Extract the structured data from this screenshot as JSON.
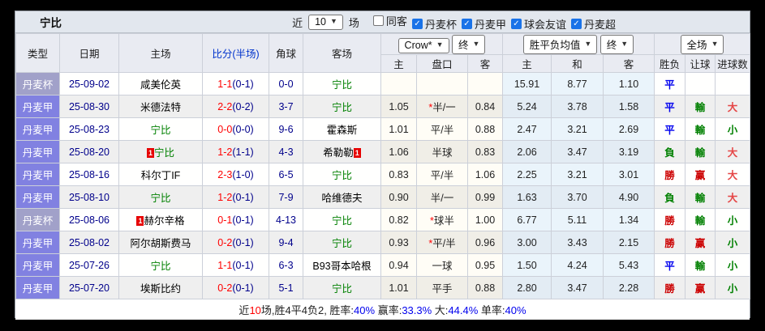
{
  "titlebar": {
    "title": "宁比",
    "near_label": "近",
    "count_value": "10",
    "unit_label": "场",
    "filters": [
      {
        "label": "同客",
        "checked": false
      },
      {
        "label": "丹麦杯",
        "checked": true
      },
      {
        "label": "丹麦甲",
        "checked": true
      },
      {
        "label": "球会友谊",
        "checked": true
      },
      {
        "label": "丹麦超",
        "checked": true
      }
    ]
  },
  "header": {
    "cols": {
      "type": "类型",
      "date": "日期",
      "home": "主场",
      "score": "比分(半场)",
      "corner": "角球",
      "away": "客场",
      "sub": [
        "主",
        "盘口",
        "客",
        "主",
        "和",
        "客",
        "胜负",
        "让球",
        "进球数"
      ]
    },
    "selects": {
      "bookmaker": "Crow*",
      "bookmaker_state": "终",
      "avg": "胜平负均值",
      "avg_state": "终",
      "scope": "全场"
    }
  },
  "table": {
    "rows": [
      {
        "type": "丹麦杯",
        "date": "25-09-02",
        "home": "咸美伦英",
        "home_green": false,
        "home_card": "",
        "score": "1-1",
        "half": "(0-1)",
        "corner": "0-0",
        "away": "宁比",
        "away_green": true,
        "away_card": "",
        "odds_home": "",
        "handicap": "",
        "handicap_star": false,
        "odds_away": "",
        "avg_win": "15.91",
        "avg_draw": "8.77",
        "avg_lose": "1.10",
        "result": "平",
        "handicap_result": "",
        "goals": ""
      },
      {
        "type": "丹麦甲",
        "date": "25-08-30",
        "home": "米德法特",
        "home_green": false,
        "home_card": "",
        "score": "2-2",
        "half": "(0-2)",
        "corner": "3-7",
        "away": "宁比",
        "away_green": true,
        "away_card": "",
        "odds_home": "1.05",
        "handicap": "半/一",
        "handicap_star": true,
        "odds_away": "0.84",
        "avg_win": "5.24",
        "avg_draw": "3.78",
        "avg_lose": "1.58",
        "result": "平",
        "handicap_result": "輸",
        "goals": "大"
      },
      {
        "type": "丹麦甲",
        "date": "25-08-23",
        "home": "宁比",
        "home_green": true,
        "home_card": "",
        "score": "0-0",
        "half": "(0-0)",
        "corner": "9-6",
        "away": "霍森斯",
        "away_green": false,
        "away_card": "",
        "odds_home": "1.01",
        "handicap": "平/半",
        "handicap_star": false,
        "odds_away": "0.88",
        "avg_win": "2.47",
        "avg_draw": "3.21",
        "avg_lose": "2.69",
        "result": "平",
        "handicap_result": "輸",
        "goals": "小"
      },
      {
        "type": "丹麦甲",
        "date": "25-08-20",
        "home": "宁比",
        "home_green": true,
        "home_card": "1",
        "score": "1-2",
        "half": "(1-1)",
        "corner": "4-3",
        "away": "希勒勒",
        "away_green": false,
        "away_card": "1",
        "odds_home": "1.06",
        "handicap": "半球",
        "handicap_star": false,
        "odds_away": "0.83",
        "avg_win": "2.06",
        "avg_draw": "3.47",
        "avg_lose": "3.19",
        "result": "負",
        "handicap_result": "輸",
        "goals": "大"
      },
      {
        "type": "丹麦甲",
        "date": "25-08-16",
        "home": "科尔丁IF",
        "home_green": false,
        "home_card": "",
        "score": "2-3",
        "half": "(1-0)",
        "corner": "6-5",
        "away": "宁比",
        "away_green": true,
        "away_card": "",
        "odds_home": "0.83",
        "handicap": "平/半",
        "handicap_star": false,
        "odds_away": "1.06",
        "avg_win": "2.25",
        "avg_draw": "3.21",
        "avg_lose": "3.01",
        "result": "勝",
        "handicap_result": "赢",
        "goals": "大"
      },
      {
        "type": "丹麦甲",
        "date": "25-08-10",
        "home": "宁比",
        "home_green": true,
        "home_card": "",
        "score": "1-2",
        "half": "(0-1)",
        "corner": "7-9",
        "away": "哈维德夫",
        "away_green": false,
        "away_card": "",
        "odds_home": "0.90",
        "handicap": "半/一",
        "handicap_star": false,
        "odds_away": "0.99",
        "avg_win": "1.63",
        "avg_draw": "3.70",
        "avg_lose": "4.90",
        "result": "負",
        "handicap_result": "輸",
        "goals": "大"
      },
      {
        "type": "丹麦杯",
        "date": "25-08-06",
        "home": "赫尔辛格",
        "home_green": false,
        "home_card": "1",
        "score": "0-1",
        "half": "(0-1)",
        "corner": "4-13",
        "away": "宁比",
        "away_green": true,
        "away_card": "",
        "odds_home": "0.82",
        "handicap": "球半",
        "handicap_star": true,
        "odds_away": "1.00",
        "avg_win": "6.77",
        "avg_draw": "5.11",
        "avg_lose": "1.34",
        "result": "勝",
        "handicap_result": "輸",
        "goals": "小"
      },
      {
        "type": "丹麦甲",
        "date": "25-08-02",
        "home": "阿尔胡斯费马",
        "home_green": false,
        "home_card": "",
        "score": "0-2",
        "half": "(0-1)",
        "corner": "9-4",
        "away": "宁比",
        "away_green": true,
        "away_card": "",
        "odds_home": "0.93",
        "handicap": "平/半",
        "handicap_star": true,
        "odds_away": "0.96",
        "avg_win": "3.00",
        "avg_draw": "3.43",
        "avg_lose": "2.15",
        "result": "勝",
        "handicap_result": "赢",
        "goals": "小"
      },
      {
        "type": "丹麦甲",
        "date": "25-07-26",
        "home": "宁比",
        "home_green": true,
        "home_card": "",
        "score": "1-1",
        "half": "(0-1)",
        "corner": "6-3",
        "away": "B93哥本哈根",
        "away_green": false,
        "away_card": "",
        "odds_home": "0.94",
        "handicap": "一球",
        "handicap_star": false,
        "odds_away": "0.95",
        "avg_win": "1.50",
        "avg_draw": "4.24",
        "avg_lose": "5.43",
        "result": "平",
        "handicap_result": "輸",
        "goals": "小"
      },
      {
        "type": "丹麦甲",
        "date": "25-07-20",
        "home": "埃斯比约",
        "home_green": false,
        "home_card": "",
        "score": "0-2",
        "half": "(0-1)",
        "corner": "5-1",
        "away": "宁比",
        "away_green": true,
        "away_card": "",
        "odds_home": "1.01",
        "handicap": "平手",
        "handicap_star": false,
        "odds_away": "0.88",
        "avg_win": "2.80",
        "avg_draw": "3.47",
        "avg_lose": "2.28",
        "result": "勝",
        "handicap_result": "赢",
        "goals": "小"
      }
    ]
  },
  "footer": {
    "segments": [
      {
        "text": "近",
        "color": ""
      },
      {
        "text": "10",
        "color": "red"
      },
      {
        "text": "场,胜4平4负2, 胜率:",
        "color": ""
      },
      {
        "text": "40%",
        "color": "blue"
      },
      {
        "text": " 赢率:",
        "color": ""
      },
      {
        "text": "33.3%",
        "color": "blue"
      },
      {
        "text": " 大:",
        "color": ""
      },
      {
        "text": "44.4%",
        "color": "blue"
      },
      {
        "text": " 单率:",
        "color": ""
      },
      {
        "text": "40%",
        "color": "blue"
      }
    ]
  },
  "colors": {
    "accent_checkbox": "#1a73e8",
    "type_cup_bg": "#a1a1c9",
    "type_league_bg": "#8181e1",
    "team_highlight": "#008000",
    "score_main": "#ff0000",
    "score_half": "#00008b",
    "result_win": "#cc0000",
    "result_draw": "#0000ee",
    "result_lose": "#008000",
    "avg_col_bg": "#eaf4fb"
  }
}
